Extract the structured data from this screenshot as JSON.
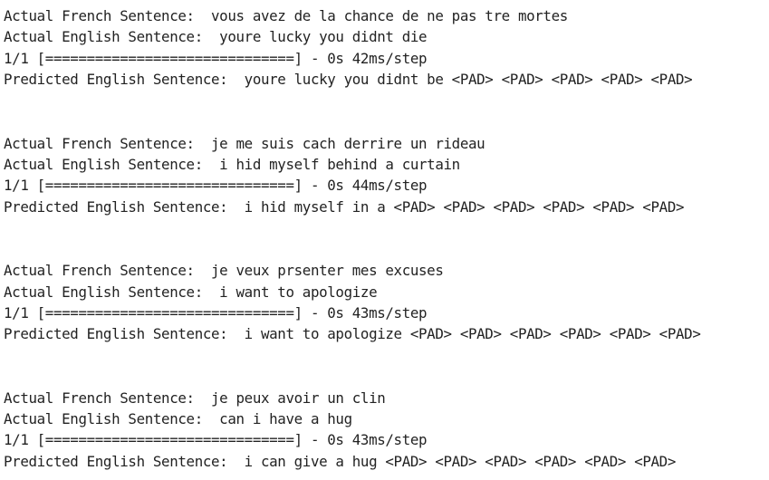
{
  "output": {
    "blocks": [
      {
        "french": "Actual French Sentence:  vous avez de la chance de ne pas tre mortes",
        "english": "Actual English Sentence:  youre lucky you didnt die",
        "progress": "1/1 [==============================] - 0s 42ms/step",
        "predicted": "Predicted English Sentence:  youre lucky you didnt be <PAD> <PAD> <PAD> <PAD> <PAD>"
      },
      {
        "french": "Actual French Sentence:  je me suis cach derrire un rideau",
        "english": "Actual English Sentence:  i hid myself behind a curtain",
        "progress": "1/1 [==============================] - 0s 44ms/step",
        "predicted": "Predicted English Sentence:  i hid myself in a <PAD> <PAD> <PAD> <PAD> <PAD> <PAD>"
      },
      {
        "french": "Actual French Sentence:  je veux prsenter mes excuses",
        "english": "Actual English Sentence:  i want to apologize",
        "progress": "1/1 [==============================] - 0s 43ms/step",
        "predicted": "Predicted English Sentence:  i want to apologize <PAD> <PAD> <PAD> <PAD> <PAD> <PAD>"
      },
      {
        "french": "Actual French Sentence:  je peux avoir un clin",
        "english": "Actual English Sentence:  can i have a hug",
        "progress": "1/1 [==============================] - 0s 43ms/step",
        "predicted": "Predicted English Sentence:  i can give a hug <PAD> <PAD> <PAD> <PAD> <PAD> <PAD>"
      }
    ]
  }
}
